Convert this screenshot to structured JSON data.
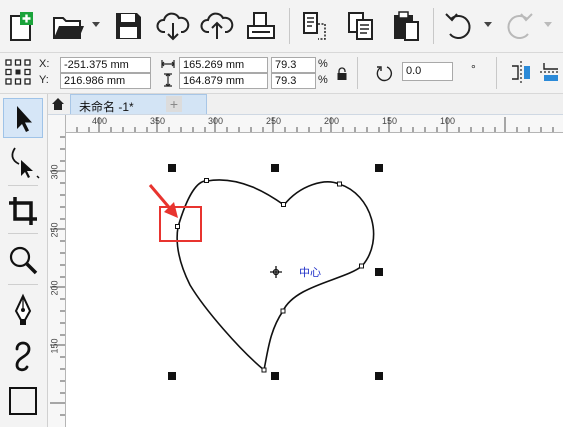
{
  "toolbar": {
    "items": [
      "new-document",
      "open",
      "save",
      "import",
      "export",
      "print",
      "copy-properties",
      "copy",
      "paste",
      "undo",
      "redo"
    ]
  },
  "propbar": {
    "x_label": "X:",
    "y_label": "Y:",
    "x_value": "-251.375 mm",
    "y_value": "216.986 mm",
    "width_value": "165.269 mm",
    "height_value": "164.879 mm",
    "scale_x": "79.3",
    "scale_y": "79.3",
    "percent": "%",
    "rotation": "0.0"
  },
  "tab": {
    "document_name": "未命名 -1*",
    "add_label": "+"
  },
  "ruler": {
    "h_ticks": [
      "400",
      "350",
      "300",
      "250",
      "200",
      "150",
      "100"
    ],
    "v_ticks": [
      "300",
      "250",
      "200",
      "150"
    ]
  },
  "canvas": {
    "center_label": "中心"
  },
  "colors": {
    "accent": "#e8342f",
    "selection_tab": "#d3e4f5",
    "center_text": "#1f2fc8"
  }
}
